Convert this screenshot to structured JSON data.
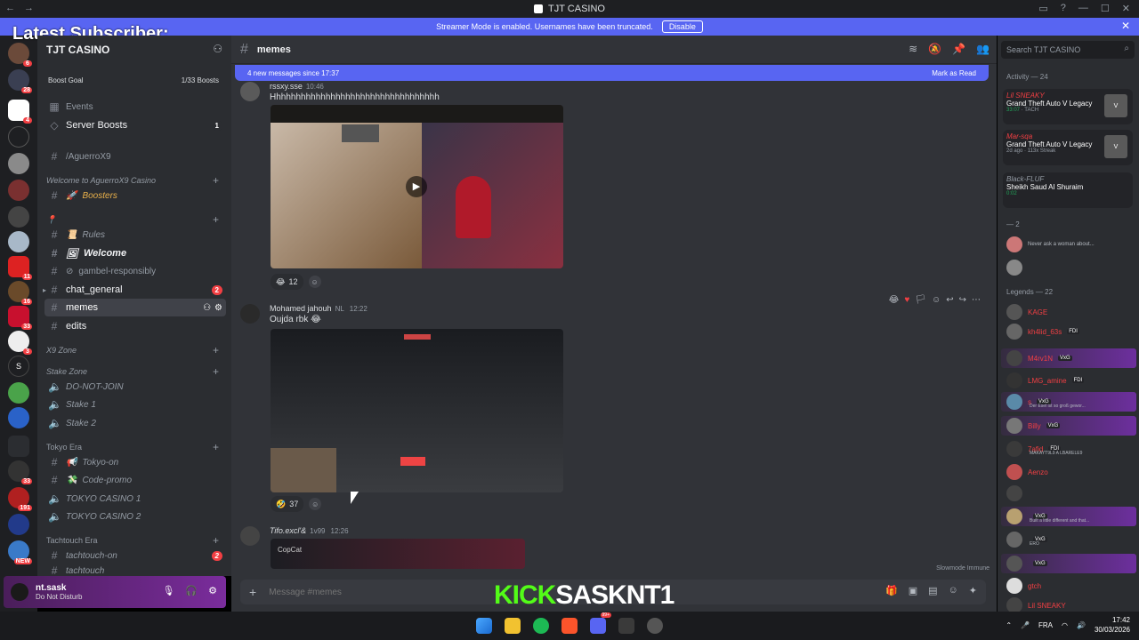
{
  "window": {
    "title": "TJT CASINO",
    "nav_back": "←",
    "nav_fwd": "→"
  },
  "banner": {
    "text": "Streamer Mode is enabled. Usernames have been truncated.",
    "button": "Disable"
  },
  "overlay": {
    "latest_subscriber": "Latest Subscriber:",
    "kick_prefix": "KICK",
    "kick_name": "SASKNT1"
  },
  "server_rail": {
    "badges": [
      "6",
      "28",
      "4",
      "",
      "",
      "",
      "",
      "11",
      "16",
      "33",
      "3",
      "",
      "",
      "33",
      "191",
      "",
      "NEW"
    ]
  },
  "sidebar": {
    "server_name": "TJT CASINO",
    "boost_goal": "Boost Goal",
    "boost_count": "1/33 Boosts",
    "events": "Events",
    "server_boosts": "Server Boosts",
    "server_boosts_badge": "1",
    "aguerro": "/AguerroX9",
    "cat_welcome": "Welcome to AguerroX9 Casino",
    "boosters": "Boosters",
    "rules": "Rules",
    "welcome": "Welcome",
    "gambel": "gambel-responsibly",
    "chat_general": "chat_general",
    "chat_general_badge": "2",
    "memes": "memes",
    "edits": "edits",
    "cat_x9": "X9 Zone",
    "cat_stake": "Stake Zone",
    "donotjoin": "DO-NOT-JOIN",
    "stake1": "Stake 1",
    "stake2": "Stake 2",
    "cat_tokyo": "Tokyo Era",
    "tokyoon": "Tokyo-on",
    "codepromo": "Code-promo",
    "tokyocasino1": "TOKYO CASINO 1",
    "tokyocasino2": "TOKYO CASINO 2",
    "cat_tachtouch": "Tachtouch Era",
    "tachtouchon": "tachtouch-on",
    "tachtouchon_badge": "2",
    "tachtouch": "tachtouch"
  },
  "user": {
    "name": "nt.sask",
    "status": "Do Not Disturb"
  },
  "channel": {
    "name": "memes",
    "new_messages": "4 new messages since 17:37",
    "mark_read": "Mark as Read"
  },
  "messages": [
    {
      "author": "rssxy.sse",
      "time": "10:46",
      "text": "Hhhhhhhhhhhhhhhhhhhhhhhhhhhhhhhhhh",
      "reaction_count": "12"
    },
    {
      "author": "Mohamed jahouh",
      "tag": "NL",
      "time": "12:22",
      "text": "Oujda rbk 😂",
      "reaction_count": "37"
    },
    {
      "author": "Tifo.excl'&",
      "tag": "1v99",
      "time": "12:26",
      "text": "",
      "embed": "CopCat"
    }
  ],
  "composer": {
    "placeholder": "Message #memes",
    "slowmode": "Slowmode Immune"
  },
  "members": {
    "search_placeholder": "Search TJT CASINO",
    "activity_head": "Activity — 24",
    "activities": [
      {
        "user": "Lil SNEAKY",
        "game": "Grand Theft Auto V Legacy",
        "time": "33:07",
        "extra": "TACH"
      },
      {
        "user": "Mar-sqa",
        "game": "Grand Theft Auto V Legacy",
        "time": "2d ago",
        "extra": "113x Streak"
      },
      {
        "user": "Black-FLUF",
        "game": "Sheikh Saud Al Shuraim",
        "time": "0:02",
        "extra": ""
      }
    ],
    "group2_head": "— 2",
    "group2_line": "Never ask a woman about...",
    "legends_head": "Legends — 22",
    "legends": [
      {
        "name": "KAGE",
        "tag": "",
        "sub": ""
      },
      {
        "name": "kh4lid_63s",
        "tag": "FDI",
        "sub": ""
      },
      {
        "name": "M4rv1N",
        "tag": "VxG",
        "sub": ""
      },
      {
        "name": "LMG_amine",
        "tag": "FDI",
        "sub": ""
      },
      {
        "name": "s",
        "tag": "VxG",
        "sub": "Der Esel ist so groß gewor..."
      },
      {
        "name": "Billy",
        "tag": "VxG",
        "sub": ""
      },
      {
        "name": "7afid",
        "tag": "FDI",
        "sub": "MAKAYT9L9 A LBARELE9"
      },
      {
        "name": "Aenzo",
        "tag": "",
        "sub": ""
      },
      {
        "name": "",
        "tag": "",
        "sub": ""
      },
      {
        "name": "",
        "tag": "VxG",
        "sub": "Built a little different and that..."
      },
      {
        "name": "",
        "tag": "VxG",
        "sub": "ERO"
      },
      {
        "name": "",
        "tag": "VxG",
        "sub": ""
      },
      {
        "name": "gtch",
        "tag": "",
        "sub": ""
      },
      {
        "name": "Lil SNEAKY",
        "tag": "",
        "sub": ""
      }
    ]
  },
  "taskbar": {
    "time": "17:42",
    "date": "30/03/2026",
    "lang": "FRA",
    "discord_badge": "99+"
  },
  "colors": {
    "accent": "#5865f2",
    "danger": "#f23f43",
    "kick_green": "#53fc18"
  }
}
